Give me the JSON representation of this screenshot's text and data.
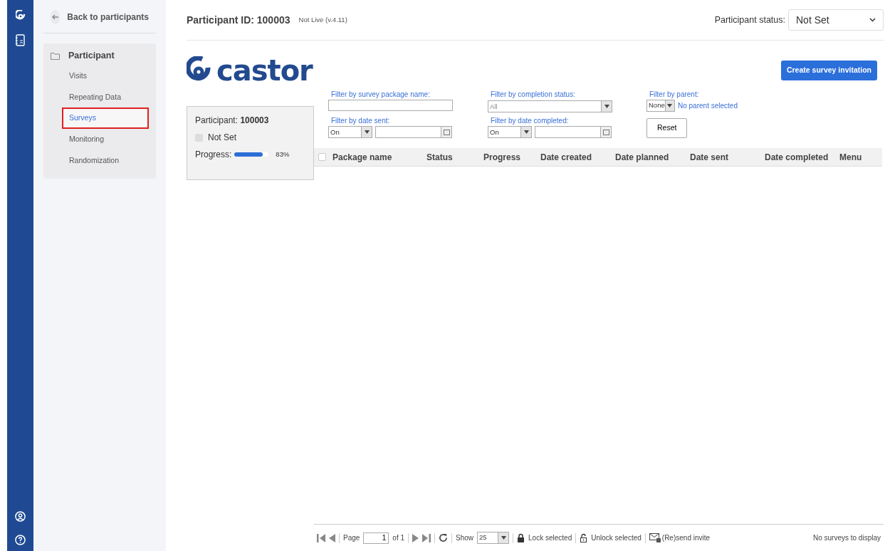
{
  "sidebar": {
    "back_link": "Back to participants",
    "section_title": "Participant",
    "items": [
      {
        "label": "Visits",
        "selected": false
      },
      {
        "label": "Repeating Data",
        "selected": false
      },
      {
        "label": "Surveys",
        "selected": true
      },
      {
        "label": "Monitoring",
        "selected": false
      },
      {
        "label": "Randomization",
        "selected": false
      }
    ]
  },
  "header": {
    "participant_id": "Participant ID: 100003",
    "version": "Not Live (v.4.11)",
    "status_label": "Participant status:",
    "status_value": "Not Set"
  },
  "logo": {
    "text": "castor"
  },
  "summary": {
    "participant_label": "Participant:",
    "participant_value": "100003",
    "status": "Not Set",
    "progress_label": "Progress:",
    "level": 0.83,
    "reading": "83%"
  },
  "create_button": "Create survey invitation",
  "filters": {
    "package_name": {
      "label": "Filter by survey package name:"
    },
    "completion_status": {
      "label": "Filter by completion status:",
      "value": "All"
    },
    "parent": {
      "label": "Filter by parent:",
      "value": "None",
      "note": "No parent selected"
    },
    "date_sent": {
      "label": "Filter by date sent:",
      "operator": "On"
    },
    "date_completed": {
      "label": "Filter by date completed:",
      "operator": "On"
    },
    "reset": "Reset"
  },
  "table": {
    "select_all_checked": false,
    "columns": [
      "Package name",
      "Status",
      "Progress",
      "Date created",
      "Date planned",
      "Date sent",
      "Date completed",
      "Menu"
    ]
  },
  "pager": {
    "page_label": "Page",
    "page": "1",
    "of": "of 1",
    "show_label": "Show",
    "show_value": "25",
    "lock": "Lock selected",
    "unlock": "Unlock selected",
    "resend": "(Re)send invite",
    "status": "No surveys to display"
  }
}
